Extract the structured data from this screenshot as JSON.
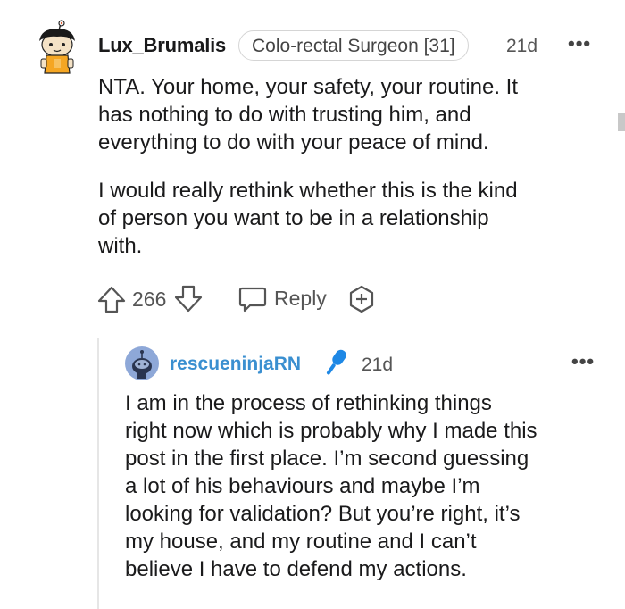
{
  "comment": {
    "username": "Lux_Brumalis",
    "flair": "Colo-rectal Surgeon [31]",
    "time": "21d",
    "more": "•••",
    "paragraphs": [
      "NTA. Your home, your safety, your routine. It\nhas nothing to do with trusting him, and\neverything to do with your peace of mind.",
      "I would really rethink whether this is the kind\nof person you want to be in a relationship\nwith."
    ],
    "actions": {
      "score": "266",
      "reply_label": "Reply"
    }
  },
  "reply": {
    "username": "rescueninjaRN",
    "time": "21d",
    "more": "•••",
    "text": "I am in the process of rethinking things\nright now which is probably why I made this\npost in the first place. I’m second guessing\na lot of his behaviours and maybe I’m\nlooking for validation? But you’re right, it’s\nmy house, and my routine and I can’t\nbelieve I have to defend my actions."
  },
  "colors": {
    "username_reply": "#3a8fd0",
    "mic_icon": "#1e88e5",
    "avatar2_bg": "#8ea8d8"
  }
}
